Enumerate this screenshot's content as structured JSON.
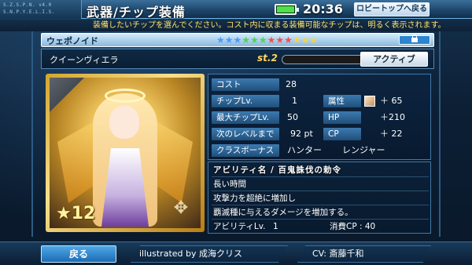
{
  "header": {
    "tags": [
      "S.Z.S.P.N. v4.0",
      "S.N.P.Y.E.L.I.S."
    ],
    "title": "武器/チップ装備",
    "battery_color": "#4fe04a",
    "clock": "20:36",
    "top_button_label": "ロビートップへ戻る"
  },
  "info_text": "装備したいチップを選んでください。コスト内に収まる装備可能なチップは、明るく表示されます。",
  "weapon": {
    "type_label": "ウェポノイド",
    "star_colors": [
      "#4a9bff",
      "#4a9bff",
      "#4a9bff",
      "#4fd64b",
      "#4fd64b",
      "#4fd64b",
      "#ff4a4a",
      "#ff4a4a",
      "#ff4a4a",
      "#ffd33a",
      "#ffd33a",
      "#ffd33a"
    ],
    "lock_icon": "lock-icon"
  },
  "character": {
    "name": "クイーンヴィエラ",
    "st_label": "st.2",
    "active_label": "アクティブ",
    "rarity_text": "★12",
    "emblem_icon": "hunter-emblem-icon"
  },
  "stats": {
    "cost_label": "コスト",
    "cost_value": "28",
    "chip_lv_label": "チップLv.",
    "chip_lv_value": "1",
    "max_lv_label": "最大チップLv.",
    "max_lv_value": "50",
    "next_label": "次のレベルまで",
    "next_value": "92 pt",
    "class_label": "クラスボーナス",
    "class_hunter": "ハンター",
    "class_ranger": "レンジャー",
    "attr_label": "属性",
    "attr_icon": "light-element-icon",
    "attr_value": "＋ 65",
    "hp_label": "HP",
    "hp_value": "＋210",
    "cp_label": "CP",
    "cp_value": "＋ 22"
  },
  "ability": {
    "name_line": "アビリティ名 / 百鬼誅伐の勅令",
    "duration": "長い時間",
    "effect1": "攻撃力を超絶に増加し",
    "effect2": "覇滅種に与えるダメージを増加する。",
    "lv_label": "アビリティLv.",
    "lv_value": "1",
    "cost_label": "消費CP : 40"
  },
  "footer": {
    "back_label": "戻る",
    "illustrated": "illustrated by  成海クリス",
    "cv": "CV: 斎藤千和"
  }
}
